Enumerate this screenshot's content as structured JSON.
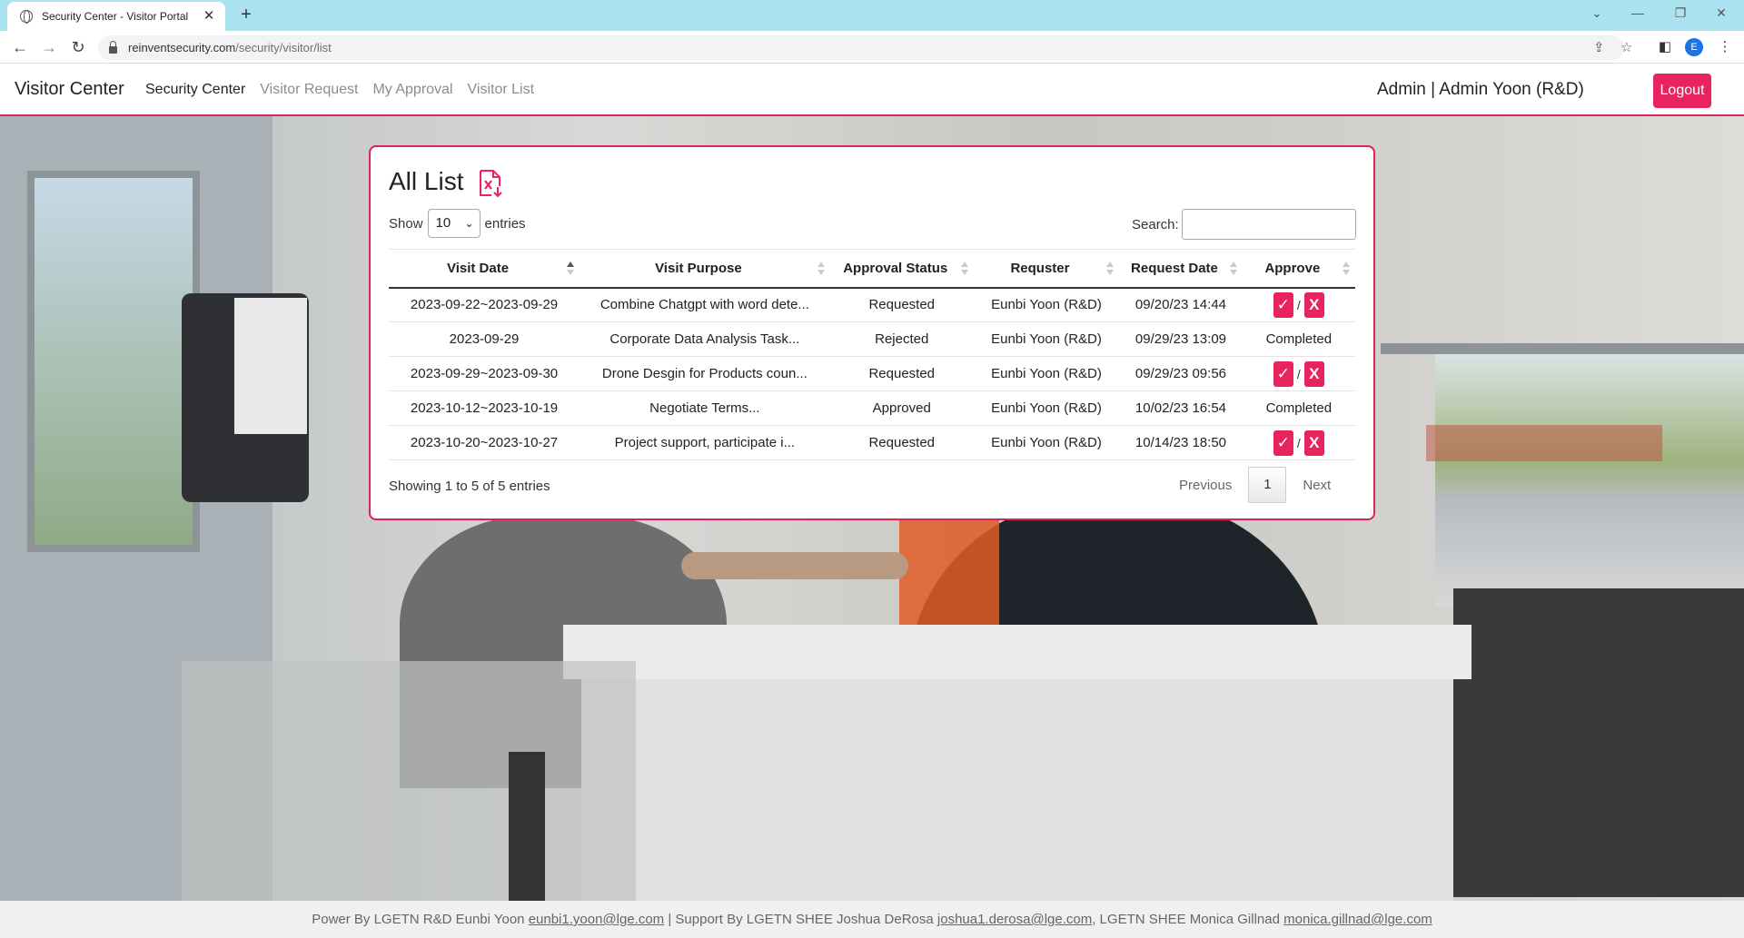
{
  "browser": {
    "tab_title": "Security Center - Visitor Portal",
    "tab_close": "✕",
    "new_tab": "+",
    "url_domain": "reinventsecurity.com",
    "url_path": "/security/visitor/list",
    "profile_initial": "E"
  },
  "navbar": {
    "brand": "Visitor Center",
    "links": [
      "Security Center",
      "Visitor Request",
      "My Approval",
      "Visitor List"
    ],
    "active_index": 0,
    "user": "Admin | Admin Yoon (R&D)",
    "logout": "Logout",
    "accent_color": "#e8235e"
  },
  "list": {
    "title": "All List",
    "export_icon": "excel-export-icon",
    "show_label": "Show",
    "entries_label": "entries",
    "page_size": "10",
    "search_label": "Search:",
    "search_value": "",
    "columns": [
      "Visit Date",
      "Visit Purpose",
      "Approval Status",
      "Requster",
      "Request Date",
      "Approve"
    ],
    "sorted_column": "Visit Date",
    "rows": [
      {
        "visit_date": "2023-09-22~2023-09-29",
        "purpose": "Combine Chatgpt with word dete...",
        "status": "Requested",
        "requester": "Eunbi Yoon (R&D)",
        "request_date": "09/20/23 14:44",
        "approve": {
          "type": "actions",
          "approve": "✓",
          "sep": "/",
          "reject": "X"
        }
      },
      {
        "visit_date": "2023-09-29",
        "purpose": "Corporate Data Analysis Task...",
        "status": "Rejected",
        "requester": "Eunbi Yoon (R&D)",
        "request_date": "09/29/23 13:09",
        "approve": {
          "type": "text",
          "text": "Completed"
        }
      },
      {
        "visit_date": "2023-09-29~2023-09-30",
        "purpose": "Drone Desgin for Products coun...",
        "status": "Requested",
        "requester": "Eunbi Yoon (R&D)",
        "request_date": "09/29/23 09:56",
        "approve": {
          "type": "actions",
          "approve": "✓",
          "sep": "/",
          "reject": "X"
        }
      },
      {
        "visit_date": "2023-10-12~2023-10-19",
        "purpose": "Negotiate Terms...",
        "status": "Approved",
        "requester": "Eunbi Yoon (R&D)",
        "request_date": "10/02/23 16:54",
        "approve": {
          "type": "text",
          "text": "Completed"
        }
      },
      {
        "visit_date": "2023-10-20~2023-10-27",
        "purpose": "Project support, participate i...",
        "status": "Requested",
        "requester": "Eunbi Yoon (R&D)",
        "request_date": "10/14/23 18:50",
        "approve": {
          "type": "actions",
          "approve": "✓",
          "sep": "/",
          "reject": "X"
        }
      }
    ],
    "info": "Showing 1 to 5 of 5 entries",
    "pager": {
      "previous": "Previous",
      "current": "1",
      "next": "Next"
    }
  },
  "footer": {
    "prefix": "Power By LGETN R&D Eunbi Yoon ",
    "email1": "eunbi1.yoon@lge.com",
    "mid": " | Support By LGETN SHEE Joshua DeRosa ",
    "email2": "joshua1.derosa@lge.com",
    "mid2": ", LGETN SHEE Monica Gillnad ",
    "email3": "monica.gillnad@lge.com"
  }
}
